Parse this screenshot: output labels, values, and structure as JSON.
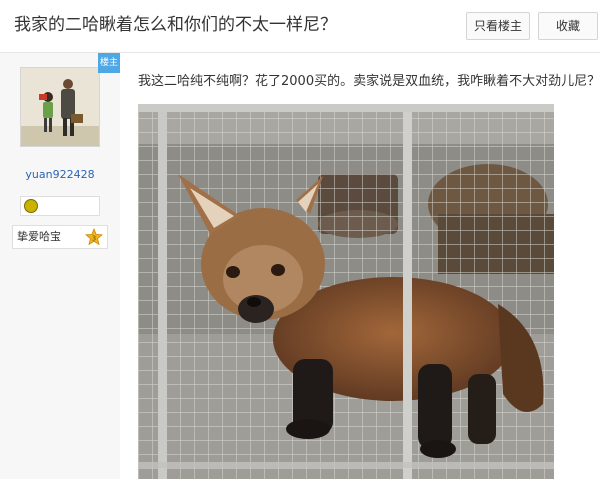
{
  "thread": {
    "title": "我家的二哈瞅着怎么和你们的不太一样尼？",
    "buttons": {
      "only_host": "只看楼主",
      "favorite": "收藏"
    }
  },
  "author": {
    "badge": "楼主",
    "username": "yuan922428",
    "title_label": "挚爱哈宝",
    "level_badge": "3"
  },
  "post": {
    "text": "我这二哈纯不纯啊？花了2000买的。卖家说是双血统，我咋瞅着不大对劲儿尼？"
  }
}
